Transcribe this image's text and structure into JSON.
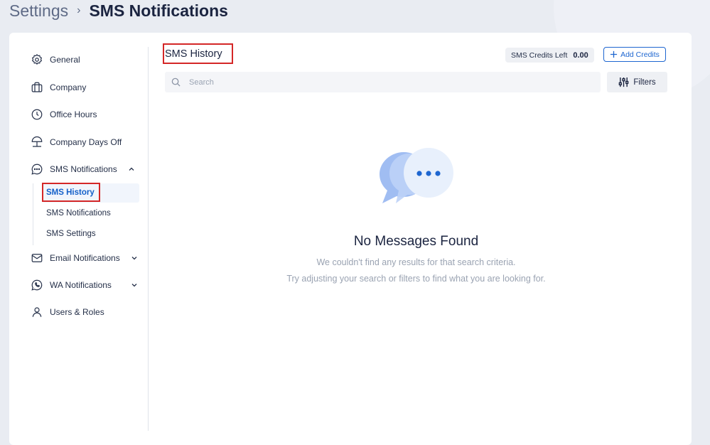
{
  "breadcrumb": {
    "root": "Settings",
    "separator": "›",
    "current": "SMS Notifications"
  },
  "sidebar": {
    "items": [
      {
        "label": "General",
        "icon": "gear-icon"
      },
      {
        "label": "Company",
        "icon": "briefcase-icon"
      },
      {
        "label": "Office Hours",
        "icon": "clock-icon"
      },
      {
        "label": "Company Days Off",
        "icon": "beach-umbrella-icon"
      },
      {
        "label": "SMS Notifications",
        "icon": "chat-bubble-icon",
        "expanded": true
      },
      {
        "label": "Email Notifications",
        "icon": "mail-icon"
      },
      {
        "label": "WA Notifications",
        "icon": "whatsapp-icon"
      },
      {
        "label": "Users & Roles",
        "icon": "user-icon"
      }
    ],
    "sms_sub": [
      {
        "label": "SMS History",
        "active": true
      },
      {
        "label": "SMS Notifications"
      },
      {
        "label": "SMS Settings"
      }
    ]
  },
  "main": {
    "title": "SMS History",
    "credits_label": "SMS Credits Left",
    "credits_value": "0.00",
    "add_credits_label": "Add Credits",
    "search_placeholder": "Search",
    "filters_label": "Filters",
    "empty": {
      "title": "No Messages Found",
      "line1": "We couldn't find any results for that search criteria.",
      "line2": "Try adjusting your search or filters to find what you are looking for."
    }
  },
  "colors": {
    "accent": "#1e66d0",
    "highlight_box": "#d42727"
  }
}
